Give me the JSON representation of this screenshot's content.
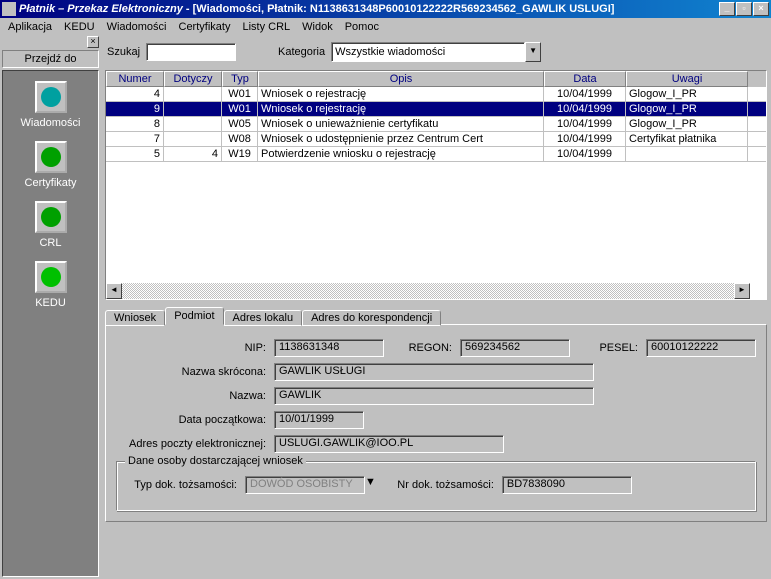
{
  "title_app": "Płatnik – Przekaz Elektroniczny",
  "title_doc": " - [Wiadomości,  Płatnik: N1138631348P60010122222R569234562_GAWLIK USLUGI]",
  "menu": {
    "aplikacja": "Aplikacja",
    "kedu": "KEDU",
    "wiadomosci": "Wiadomości",
    "certyfikaty": "Certyfikaty",
    "listy_crl": "Listy CRL",
    "widok": "Widok",
    "pomoc": "Pomoc"
  },
  "sidebar": {
    "caption": "Przejdź do",
    "items": [
      "Wiadomości",
      "Certyfikaty",
      "CRL",
      "KEDU"
    ]
  },
  "search": {
    "szukaj_label": "Szukaj",
    "szukaj_value": "",
    "kategoria_label": "Kategoria",
    "kategoria_value": "Wszystkie wiadomości"
  },
  "grid": {
    "headers": {
      "numer": "Numer",
      "dotyczy": "Dotyczy",
      "typ": "Typ",
      "opis": "Opis",
      "data": "Data",
      "uwagi": "Uwagi"
    },
    "rows": [
      {
        "numer": "4",
        "dotyczy": "",
        "typ": "W01",
        "opis": "Wniosek o rejestrację",
        "data": "10/04/1999",
        "uwagi": "Glogow_I_PR",
        "sel": false
      },
      {
        "numer": "9",
        "dotyczy": "",
        "typ": "W01",
        "opis": "Wniosek o rejestrację",
        "data": "10/04/1999",
        "uwagi": "Glogow_I_PR",
        "sel": true
      },
      {
        "numer": "8",
        "dotyczy": "",
        "typ": "W05",
        "opis": "Wniosek o unieważnienie certyfikatu",
        "data": "10/04/1999",
        "uwagi": "Glogow_I_PR",
        "sel": false
      },
      {
        "numer": "7",
        "dotyczy": "",
        "typ": "W08",
        "opis": "Wniosek o udostępnienie przez Centrum Cert",
        "data": "10/04/1999",
        "uwagi": "Certyfikat płatnika",
        "sel": false
      },
      {
        "numer": "5",
        "dotyczy": "4",
        "typ": "W19",
        "opis": "Potwierdzenie wniosku o rejestrację",
        "data": "10/04/1999",
        "uwagi": "",
        "sel": false
      }
    ]
  },
  "tabs": {
    "wniosek": "Wniosek",
    "podmiot": "Podmiot",
    "adres_lokalu": "Adres lokalu",
    "adres_koresp": "Adres do korespondencji"
  },
  "form": {
    "nip_label": "NIP:",
    "nip": "1138631348",
    "regon_label": "REGON:",
    "regon": "569234562",
    "pesel_label": "PESEL:",
    "pesel": "60010122222",
    "nazwa_skr_label": "Nazwa skrócona:",
    "nazwa_skr": "GAWLIK USŁUGI",
    "nazwa_label": "Nazwa:",
    "nazwa": "GAWLIK",
    "data_pocz_label": "Data początkowa:",
    "data_pocz": "10/01/1999",
    "email_label": "Adres poczty elektronicznej:",
    "email": "USLUGI.GAWLIK@IOO.PL",
    "group_title": "Dane osoby dostarczającej wniosek",
    "typdok_label": "Typ dok. tożsamości:",
    "typdok": "DOWÓD OSOBISTY",
    "nrdok_label": "Nr dok. tożsamości:",
    "nrdok": "BD7838090"
  }
}
